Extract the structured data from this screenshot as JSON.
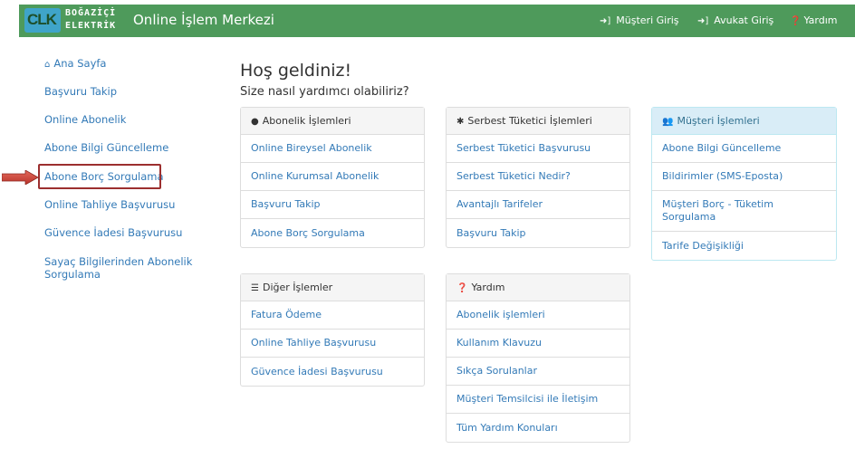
{
  "header": {
    "logo_mark": "CLK",
    "logo_line1": "BOĞAZİÇİ",
    "logo_line2": "ELEKTRİK",
    "brand": "Online İşlem Merkezi",
    "links": [
      {
        "icon": "sign-in-icon",
        "label": "Müşteri Giriş"
      },
      {
        "icon": "sign-in-icon",
        "label": "Avukat Giriş"
      },
      {
        "icon": "question-circle-icon",
        "label": "Yardım"
      }
    ]
  },
  "sidebar": {
    "items": [
      {
        "icon": "home-icon",
        "label": "Ana Sayfa"
      },
      {
        "label": "Başvuru Takip"
      },
      {
        "label": "Online Abonelik"
      },
      {
        "label": "Abone Bilgi Güncelleme"
      },
      {
        "label": "Abone Borç Sorgulama"
      },
      {
        "label": "Online Tahliye Başvurusu"
      },
      {
        "label": "Güvence İadesi Başvurusu"
      },
      {
        "label": "Sayaç Bilgilerinden Abonelik Sorgulama"
      }
    ],
    "highlight_color": "#9c2f2f",
    "arrow_color": "#c0392b"
  },
  "main": {
    "welcome": "Hoş geldiniz!",
    "subtitle": "Size nasıl yardımcı olabiliriz?",
    "panels": [
      {
        "icon": "user-icon",
        "title": "Abonelik İşlemleri",
        "items": [
          "Online Bireysel Abonelik",
          "Online Kurumsal Abonelik",
          "Başvuru Takip",
          "Abone Borç Sorgulama"
        ]
      },
      {
        "icon": "asterisk-icon",
        "title": "Serbest Tüketici İşlemleri",
        "items": [
          "Serbest Tüketici Başvurusu",
          "Serbest Tüketici Nedir?",
          "Avantajlı Tarifeler",
          "Başvuru Takip"
        ]
      },
      {
        "icon": "users-icon",
        "title": "Müşteri İşlemleri",
        "items": [
          "Abone Bilgi Güncelleme",
          "Bildirimler (SMS-Eposta)",
          "Müşteri Borç - Tüketim Sorgulama",
          "Tarife Değişikliği"
        ]
      },
      {
        "icon": "list-icon",
        "title": "Diğer İşlemler",
        "items": [
          "Fatura Ödeme",
          "Online Tahliye Başvurusu",
          "Güvence İadesi Başvurusu"
        ]
      },
      {
        "icon": "question-circle-icon",
        "title": "Yardım",
        "items": [
          "Abonelik işlemleri",
          "Kullanım Klavuzu",
          "Sıkça Sorulanlar",
          "Müşteri Temsilcisi ile İletişim",
          "Tüm Yardım Konuları"
        ]
      }
    ]
  },
  "colors": {
    "navbar": "#4e9a5b",
    "link": "#337ab7",
    "info_panel_head": "#d9edf7"
  }
}
